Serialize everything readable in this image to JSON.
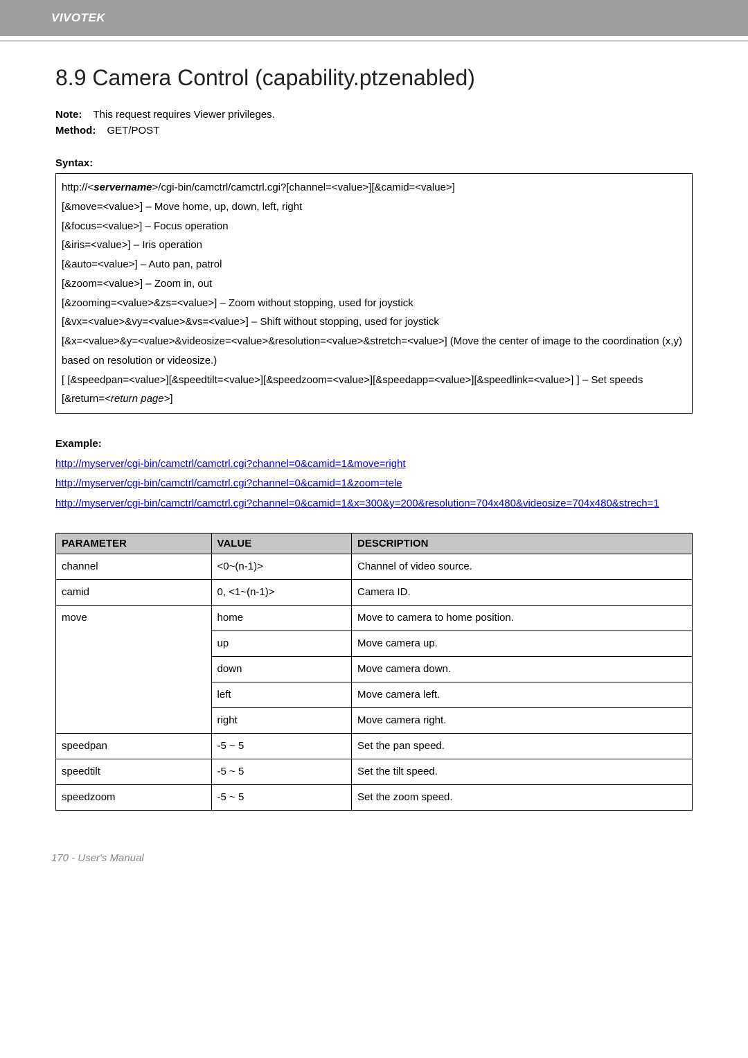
{
  "header": {
    "brand": "VIVOTEK"
  },
  "title": "8.9 Camera Control (capability.ptzenabled)",
  "meta": {
    "note_label": "Note:",
    "note_value": "This request requires Viewer privileges.",
    "method_label": "Method:",
    "method_value": "GET/POST"
  },
  "syntax": {
    "label": "Syntax:",
    "lines": [
      "http://<servername>/cgi-bin/camctrl/camctrl.cgi?[channel=<value>][&camid=<value>]",
      "[&move=<value>] – Move home, up, down, left, right",
      "[&focus=<value>] – Focus operation",
      "[&iris=<value>] – Iris operation",
      "[&auto=<value>] – Auto pan, patrol",
      "[&zoom=<value>] – Zoom in, out",
      "[&zooming=<value>&zs=<value>] – Zoom without stopping, used for joystick",
      "[&vx=<value>&vy=<value>&vs=<value>] – Shift without stopping, used for joystick",
      "[&x=<value>&y=<value>&videosize=<value>&resolution=<value>&stretch=<value>] (Move the center of image to the coordination (x,y) based on resolution or videosize.)",
      "[ [&speedpan=<value>][&speedtilt=<value>][&speedzoom=<value>][&speedapp=<value>][&speedlink=<value>] ] – Set speeds",
      "[&return=<return page>]"
    ]
  },
  "examples": {
    "label": "Example:",
    "items": [
      {
        "prefix": "",
        "url": "http://myserver/cgi-bin/camctrl/camctrl.cgi?channel=0&camid=1&move=right"
      },
      {
        "prefix": "",
        "url": "http://myserver/cgi-bin/camctrl/camctrl.cgi?channel=0&camid=1&zoom=tele"
      },
      {
        "prefix": "",
        "url": "http://myserver/cgi-bin/camctrl/camctrl.cgi?channel=0&camid=1&x=300&y=200&resolution=704x480&videosize=704x480&strech=1"
      }
    ]
  },
  "param_table": {
    "headers": [
      "PARAMETER",
      "VALUE",
      "DESCRIPTION"
    ],
    "rows": [
      {
        "param": "channel",
        "value": "<0~(n-1)>",
        "desc": "Channel of video source."
      },
      {
        "param": "camid",
        "value": "0, <1~(n-1)>",
        "desc": "Camera ID."
      },
      {
        "param": "move",
        "value": "home",
        "desc": "Move to camera to home position."
      },
      {
        "param": "",
        "value": "up",
        "desc": "Move camera up."
      },
      {
        "param": "",
        "value": "down",
        "desc": "Move camera down."
      },
      {
        "param": "",
        "value": "left",
        "desc": "Move camera left."
      },
      {
        "param": "",
        "value": "right",
        "desc": "Move camera right."
      },
      {
        "param": "speedpan",
        "value": "-5 ~ 5",
        "desc": "Set the pan speed."
      },
      {
        "param": "speedtilt",
        "value": "-5 ~ 5",
        "desc": "Set the tilt speed."
      },
      {
        "param": "speedzoom",
        "value": "-5 ~ 5",
        "desc": "Set the zoom speed."
      }
    ]
  },
  "footer": {
    "text": "170 - User's Manual"
  }
}
